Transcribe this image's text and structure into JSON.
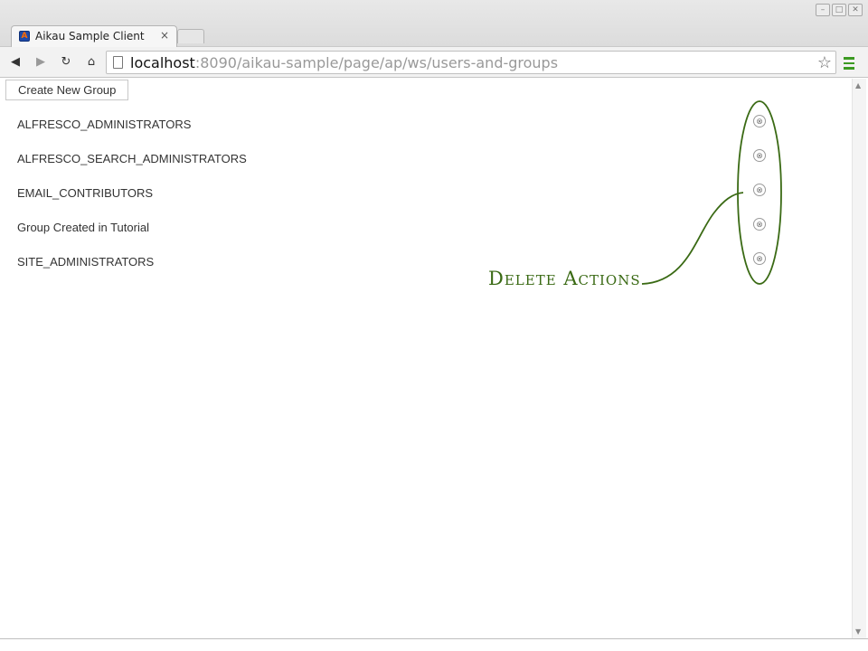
{
  "browser": {
    "tab_title": "Aikau Sample Client",
    "tab_close": "×",
    "favicon_letter": "A",
    "url_host": "localhost",
    "url_rest": ":8090/aikau-sample/page/ap/ws/users-and-groups",
    "window_controls": [
      "–",
      "□",
      "✕"
    ],
    "accent_color": "#3c9a22"
  },
  "page": {
    "create_button_label": "Create New Group",
    "groups": [
      "ALFRESCO_ADMINISTRATORS",
      "ALFRESCO_SEARCH_ADMINISTRATORS",
      "EMAIL_CONTRIBUTORS",
      "Group Created in Tutorial",
      "SITE_ADMINISTRATORS"
    ],
    "delete_icon": "⊗"
  },
  "annotation": {
    "text": "Delete Actions",
    "color": "#3a6a14"
  }
}
